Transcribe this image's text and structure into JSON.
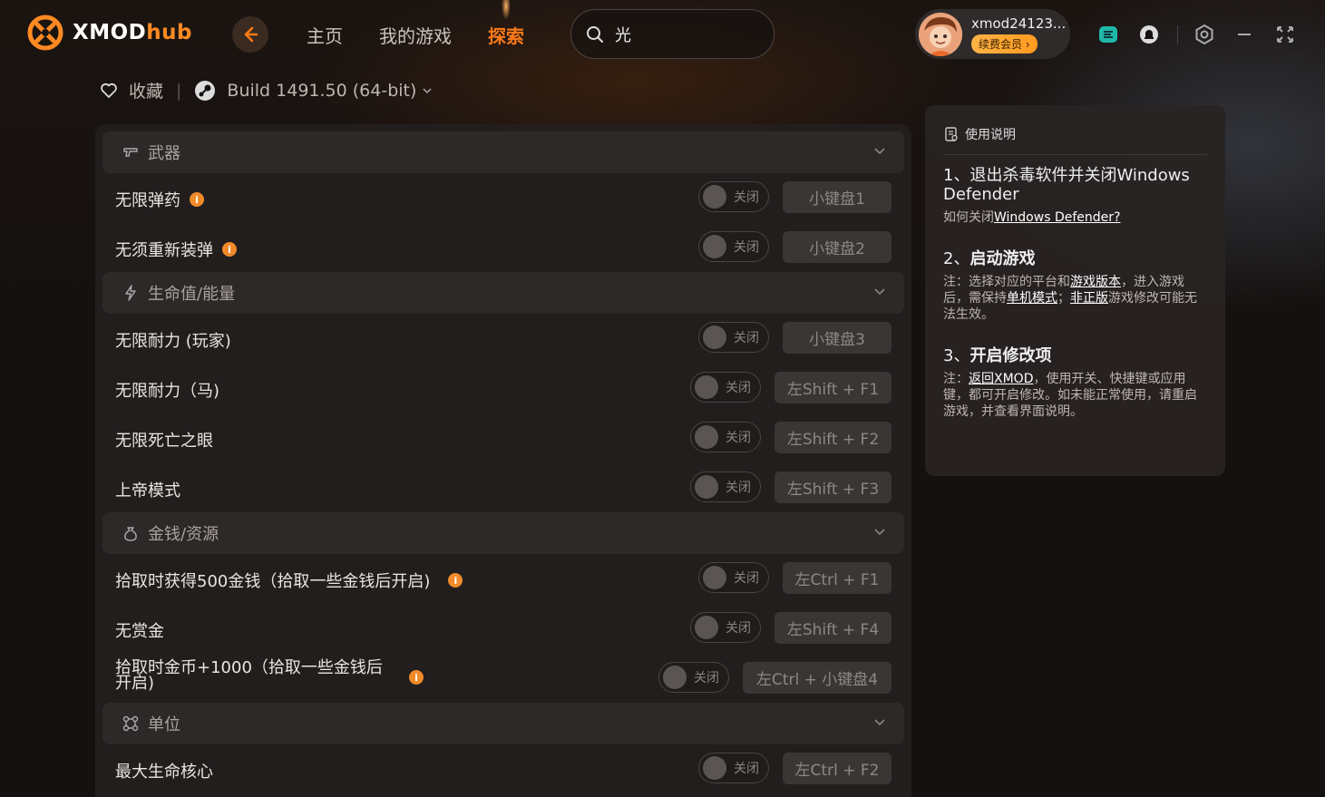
{
  "app": {
    "name_main": "XMOD",
    "name_accent": "hub"
  },
  "nav": {
    "home": "主页",
    "my_games": "我的游戏",
    "explore": "探索"
  },
  "search": {
    "value": "光"
  },
  "user": {
    "name": "xmod24123...",
    "vip_label": "续费会员 ›"
  },
  "game": {
    "favorite_label": "收藏",
    "build": "Build 1491.50 (64-bit)"
  },
  "sections": {
    "weapons": "武器",
    "health": "生命值/能量",
    "money": "金钱/资源",
    "units": "单位"
  },
  "toggle_off": "关闭",
  "options": [
    {
      "label": "无限弹药",
      "info": true,
      "hotkey": "小键盘1"
    },
    {
      "label": "无须重新装弹",
      "info": true,
      "hotkey": "小键盘2"
    },
    {
      "label": "无限耐力 (玩家)",
      "info": false,
      "hotkey": "小键盘3"
    },
    {
      "label": "无限耐力（马)",
      "info": false,
      "hotkey": "左Shift + F1"
    },
    {
      "label": "无限死亡之眼",
      "info": false,
      "hotkey": "左Shift + F2"
    },
    {
      "label": "上帝模式",
      "info": false,
      "hotkey": "左Shift + F3"
    },
    {
      "label": "拾取时获得500金钱（拾取一些金钱后开启)",
      "info": true,
      "hotkey": "左Ctrl + F1"
    },
    {
      "label": "无赏金",
      "info": false,
      "hotkey": "左Shift + F4"
    },
    {
      "label": "拾取时金币+1000（拾取一些金钱后开启)",
      "info": true,
      "hotkey": "左Ctrl + 小键盘4"
    },
    {
      "label": "最大生命核心",
      "info": false,
      "hotkey": "左Ctrl + F2"
    }
  ],
  "instructions": {
    "title": "使用说明",
    "step1_title": "1、退出杀毒软件并关闭Windows Defender",
    "step1_note_prefix": "如何关闭",
    "step1_note_link": "Windows Defender?",
    "step2_num": "2、",
    "step2_title": "启动游戏",
    "step2_note_a": "注：选择对应的平台和",
    "step2_note_link1": "游戏版本",
    "step2_note_b": "，进入游戏后，需保持",
    "step2_note_link2": "单机模式",
    "step2_note_c": "；",
    "step2_note_link3": "非正版",
    "step2_note_d": "游戏修改可能无法生效。",
    "step3_num": "3、",
    "step3_title": "开启修改项",
    "step3_note_a": "注：",
    "step3_note_link": "返回XMOD",
    "step3_note_b": "，使用开关、快捷键或应用键，都可开启修改。如未能正常使用，请重启游戏，并查看界面说明。"
  },
  "colors": {
    "accent": "#ff7a1a",
    "panel": "#24201f",
    "info_dot": "#f18a2a"
  }
}
